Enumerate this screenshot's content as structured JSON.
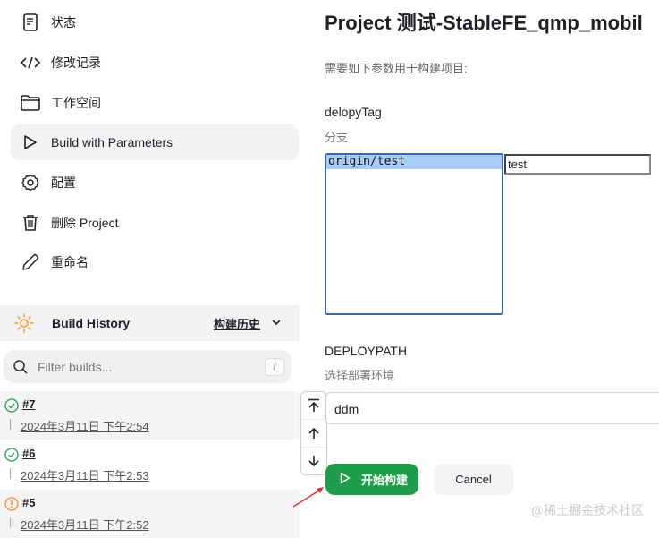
{
  "sidebar": {
    "items": [
      {
        "label": "状态",
        "icon": "document-icon"
      },
      {
        "label": "修改记录",
        "icon": "code-icon"
      },
      {
        "label": "工作空间",
        "icon": "folder-icon"
      },
      {
        "label": "Build with Parameters",
        "icon": "play-icon",
        "active": true
      },
      {
        "label": "配置",
        "icon": "gear-icon"
      },
      {
        "label": "删除 Project",
        "icon": "trash-icon"
      },
      {
        "label": "重命名",
        "icon": "pencil-icon"
      }
    ]
  },
  "build_history": {
    "title": "Build History",
    "link_label": "构建历史",
    "filter_placeholder": "Filter builds...",
    "shortcut": "/",
    "builds": [
      {
        "number": "#7",
        "date": "2024年3月11日 下午2:54",
        "status": "success"
      },
      {
        "number": "#6",
        "date": "2024年3月11日 下午2:53",
        "status": "success"
      },
      {
        "number": "#5",
        "date": "2024年3月11日 下午2:52",
        "status": "unstable"
      }
    ]
  },
  "main": {
    "title": "Project 测试-StableFE_qmp_mobil",
    "description": "需要如下参数用于构建项目:",
    "params": [
      {
        "name": "delopyTag",
        "description": "分支",
        "selected_option": "origin/test",
        "text_value": "test"
      },
      {
        "name": "DEPLOYPATH",
        "description": "选择部署环境",
        "value": "ddm"
      }
    ],
    "build_button": "开始构建",
    "cancel_button": "Cancel"
  },
  "watermark": "@稀土掘金技术社区",
  "colors": {
    "accent_green": "#1e9e4a",
    "success": "#1e9e4a",
    "unstable": "#f08a30",
    "selection": "#a8cbf7"
  }
}
